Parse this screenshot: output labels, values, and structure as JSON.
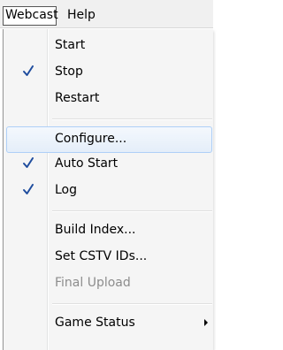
{
  "menubar": {
    "webcast": "Webcast",
    "help": "Help"
  },
  "menu": {
    "start": "Start",
    "stop": "Stop",
    "restart": "Restart",
    "configure": "Configure...",
    "auto_start": "Auto Start",
    "log": "Log",
    "build_index": "Build Index...",
    "set_cstv_ids": "Set CSTV IDs...",
    "final_upload": "Final Upload",
    "game_status": "Game Status"
  },
  "checked": {
    "stop": true,
    "auto_start": true,
    "log": true
  },
  "colors": {
    "check": "#1f4d9e",
    "disabled_text": "#8d8d8d",
    "hover_border": "#aecff7"
  },
  "icons": {
    "check": "check-icon",
    "submenu": "submenu-arrow-icon"
  }
}
